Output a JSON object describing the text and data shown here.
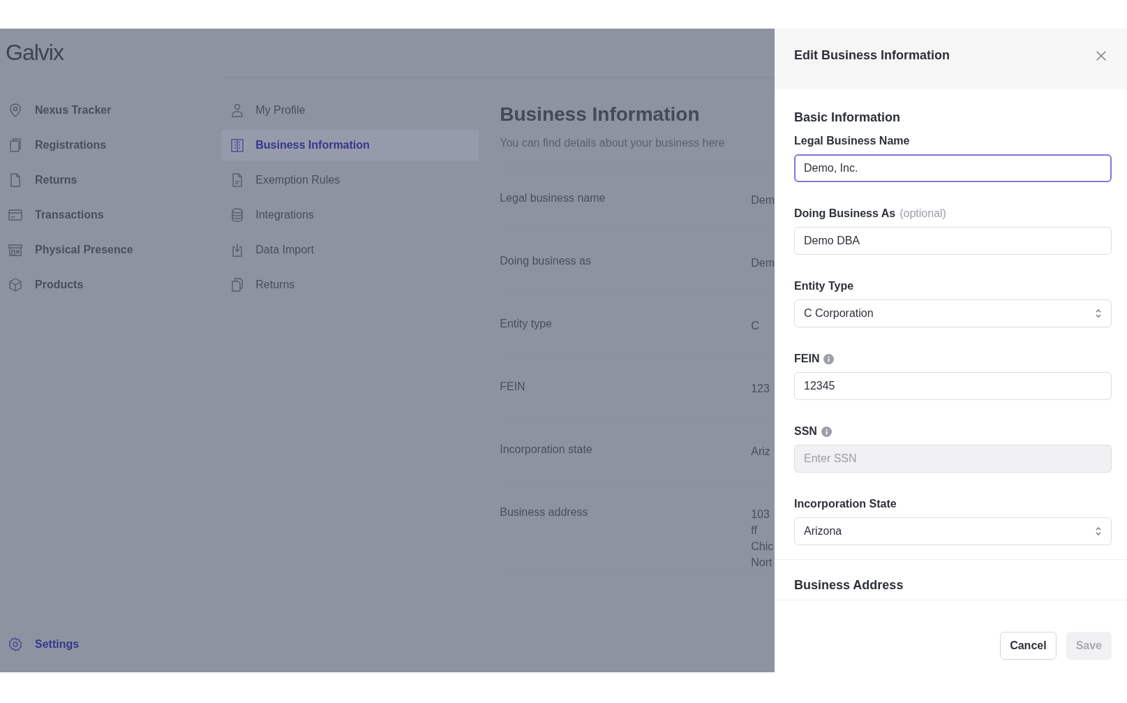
{
  "logo": "Galvix",
  "nav": {
    "items": [
      {
        "label": "Nexus Tracker",
        "selected": false
      },
      {
        "label": "Registrations",
        "selected": false
      },
      {
        "label": "Returns",
        "selected": false
      },
      {
        "label": "Transactions",
        "selected": false
      },
      {
        "label": "Physical Presence",
        "selected": false
      },
      {
        "label": "Products",
        "selected": false
      }
    ],
    "footer": {
      "label": "Settings",
      "selected": true
    }
  },
  "settings_menu": [
    {
      "label": "My Profile",
      "selected": false
    },
    {
      "label": "Business Information",
      "selected": true
    },
    {
      "label": "Exemption Rules",
      "selected": false
    },
    {
      "label": "Integrations",
      "selected": false
    },
    {
      "label": "Data Import",
      "selected": false
    },
    {
      "label": "Returns",
      "selected": false
    }
  ],
  "page": {
    "title": "Business Information",
    "subtitle": "You can find details about your business here",
    "rows": [
      {
        "label": "Legal business name",
        "value": [
          "Dem"
        ]
      },
      {
        "label": "Doing business as",
        "value": [
          "Dem"
        ]
      },
      {
        "label": "Entity type",
        "value": [
          "C"
        ]
      },
      {
        "label": "FEIN",
        "value": [
          "123"
        ]
      },
      {
        "label": "Incorporation state",
        "value": [
          "Ariz"
        ]
      },
      {
        "label": "Business address",
        "value": [
          "103",
          "ff",
          "Chic",
          "Nort"
        ]
      }
    ]
  },
  "drawer": {
    "title": "Edit Business Information",
    "section": "Basic Information",
    "fields": [
      {
        "kind": "text",
        "label": "Legal Business Name",
        "value": "Demo, Inc.",
        "focused": true,
        "disabled": false,
        "info": false
      },
      {
        "kind": "text",
        "label": "Doing Business As",
        "hint": "(optional)",
        "value": "Demo DBA",
        "focused": false,
        "disabled": false,
        "info": false
      },
      {
        "kind": "select",
        "label": "Entity Type",
        "value": "C Corporation",
        "focused": false,
        "disabled": false,
        "info": false
      },
      {
        "kind": "text",
        "label": "FEIN",
        "value": "12345",
        "focused": false,
        "disabled": false,
        "info": true
      },
      {
        "kind": "text",
        "label": "SSN",
        "placeholder": "Enter SSN",
        "focused": false,
        "disabled": true,
        "info": true
      },
      {
        "kind": "select",
        "label": "Incorporation State",
        "value": "Arizona",
        "focused": false,
        "disabled": false,
        "info": false
      }
    ],
    "next_section": "Business Address",
    "buttons": [
      {
        "label": "Cancel",
        "kind": "secondary",
        "disabled": false
      },
      {
        "label": "Save",
        "kind": "primary",
        "disabled": true
      }
    ]
  }
}
